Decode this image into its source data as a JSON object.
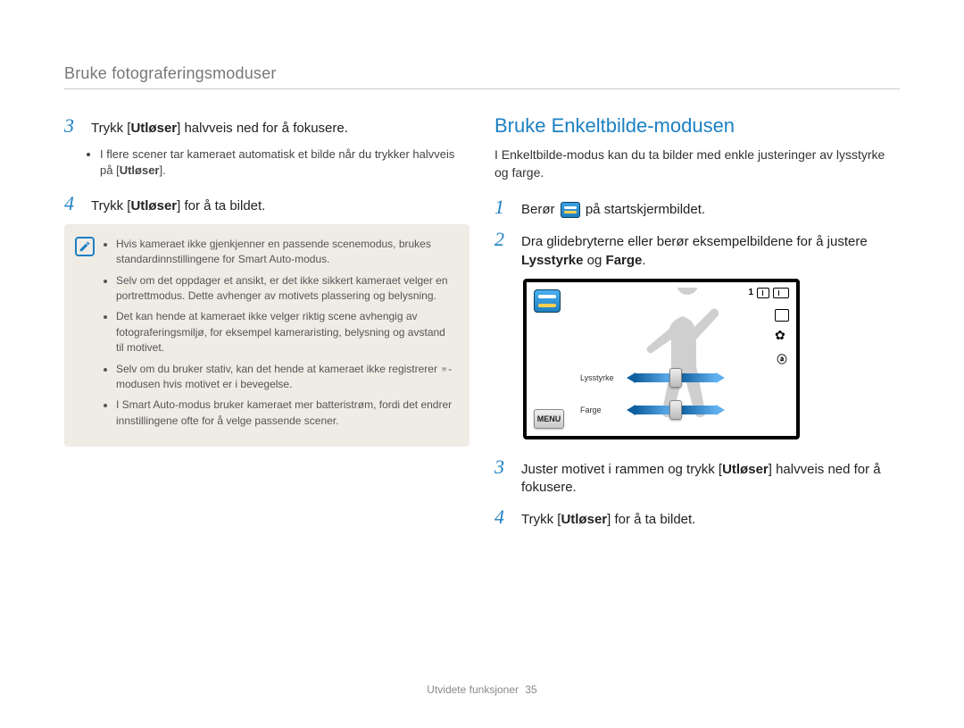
{
  "breadcrumb": "Bruke fotograferingsmoduser",
  "left": {
    "step3_num": "3",
    "step3_a": "Trykk [",
    "step3_b": "Utløser",
    "step3_c": "] halvveis ned for å fokusere.",
    "step3_bullet_a": "I flere scener tar kameraet automatisk et bilde når du trykker halvveis på [",
    "step3_bullet_b": "Utløser",
    "step3_bullet_c": "].",
    "step4_num": "4",
    "step4_a": "Trykk [",
    "step4_b": "Utløser",
    "step4_c": "] for å ta bildet.",
    "note1": "Hvis kameraet ikke gjenkjenner en passende scenemodus, brukes standardinnstillingene for Smart Auto-modus.",
    "note2": "Selv om det oppdager et ansikt, er det ikke sikkert kameraet velger en portrettmodus. Dette avhenger av motivets plassering og belysning.",
    "note3": "Det kan hende at kameraet ikke velger riktig scene avhengig av fotograferingsmiljø, for eksempel kameraristing, belysning og avstand til motivet.",
    "note4_a": "Selv om du bruker stativ, kan det hende at kameraet ikke registrerer ",
    "note4_b": "-modusen hvis motivet er i bevegelse.",
    "note5": "I Smart Auto-modus bruker kameraet mer batteristrøm, fordi det endrer innstillingene ofte for å velge passende scener."
  },
  "right": {
    "heading": "Bruke Enkeltbilde-modusen",
    "intro": "I Enkeltbilde-modus kan du ta bilder med enkle justeringer av lysstyrke og farge.",
    "step1_num": "1",
    "step1_a": "Berør ",
    "step1_b": " på startskjermbildet.",
    "step2_num": "2",
    "step2_a": "Dra glidebryterne eller berør eksempelbildene for å justere ",
    "step2_b": "Lysstyrke",
    "step2_c": " og ",
    "step2_d": "Farge",
    "step2_e": ".",
    "screen": {
      "count": "1",
      "slider1": "Lysstyrke",
      "slider2": "Farge",
      "menu": "MENU"
    },
    "step3_num": "3",
    "step3_a": "Juster motivet i rammen og trykk [",
    "step3_b": "Utløser",
    "step3_c": "] halvveis ned for å fokusere.",
    "step4_num": "4",
    "step4_a": "Trykk [",
    "step4_b": "Utløser",
    "step4_c": "] for å ta bildet."
  },
  "footer": {
    "section": "Utvidete funksjoner",
    "page": "35"
  }
}
